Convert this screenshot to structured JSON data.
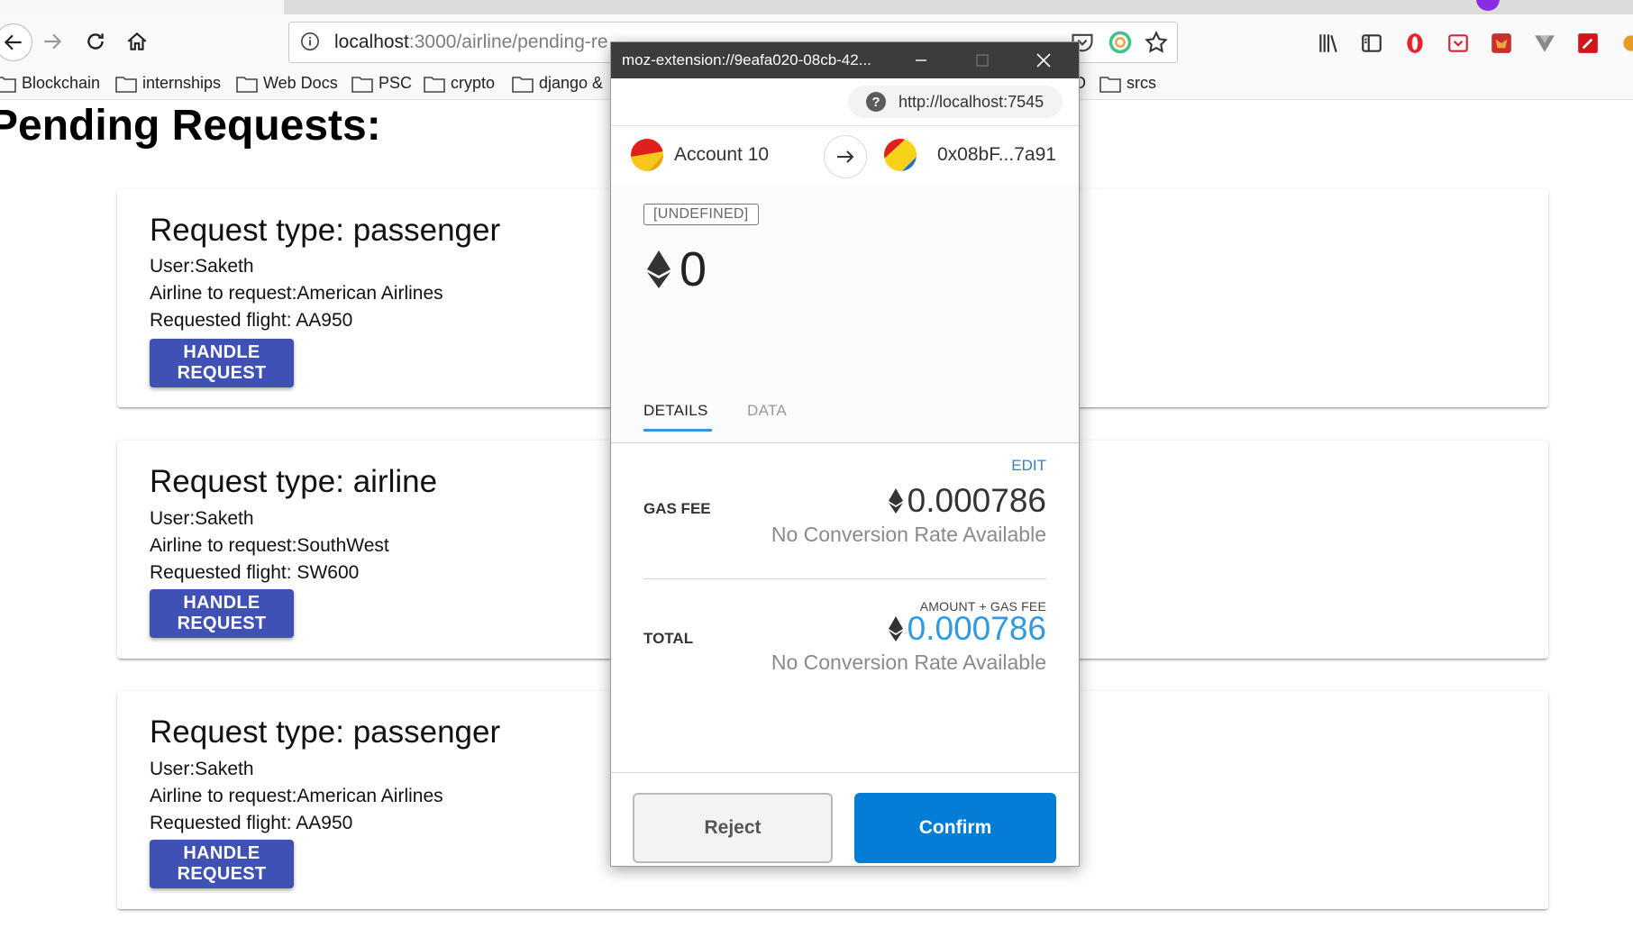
{
  "browser": {
    "url_host": "localhost",
    "url_path": ":3000/airline/pending-re",
    "bookmarks": [
      "Blockchain",
      "internships",
      "Web Docs",
      "PSC",
      "crypto",
      "django &",
      "D",
      "srcs"
    ]
  },
  "page": {
    "title": "Pending Requests:",
    "requests": [
      {
        "type": "Request type: passenger",
        "user": "User:Saketh",
        "airline": "Airline to request:American Airlines",
        "flight": "Requested flight: AA950",
        "button": "HANDLE REQUEST"
      },
      {
        "type": "Request type: airline",
        "user": "User:Saketh",
        "airline": "Airline to request:SouthWest",
        "flight": "Requested flight: SW600",
        "button": "HANDLE REQUEST"
      },
      {
        "type": "Request type: passenger",
        "user": "User:Saketh",
        "airline": "Airline to request:American Airlines",
        "flight": "Requested flight: AA950",
        "button": "HANDLE REQUEST"
      }
    ]
  },
  "popup": {
    "window_title": "moz-extension://9eafa020-08cb-42...",
    "origin": "http://localhost:7545",
    "origin_icon": "?",
    "from_account": "Account 10",
    "to_account": "0x08bF...7a91",
    "method": "[UNDEFINED]",
    "amount": "0",
    "tabs": {
      "details": "DETAILS",
      "data": "DATA"
    },
    "edit": "EDIT",
    "gas_fee_label": "GAS FEE",
    "gas_fee_value": "0.000786",
    "gas_fee_conversion": "No Conversion Rate Available",
    "amount_plus_gas": "AMOUNT + GAS FEE",
    "total_label": "TOTAL",
    "total_value": "0.000786",
    "total_conversion": "No Conversion Rate Available",
    "reject": "Reject",
    "confirm": "Confirm"
  },
  "colors": {
    "primary_button": "#3f51b5",
    "confirm_button": "#037dd6",
    "total_value": "#2f9ae0"
  }
}
